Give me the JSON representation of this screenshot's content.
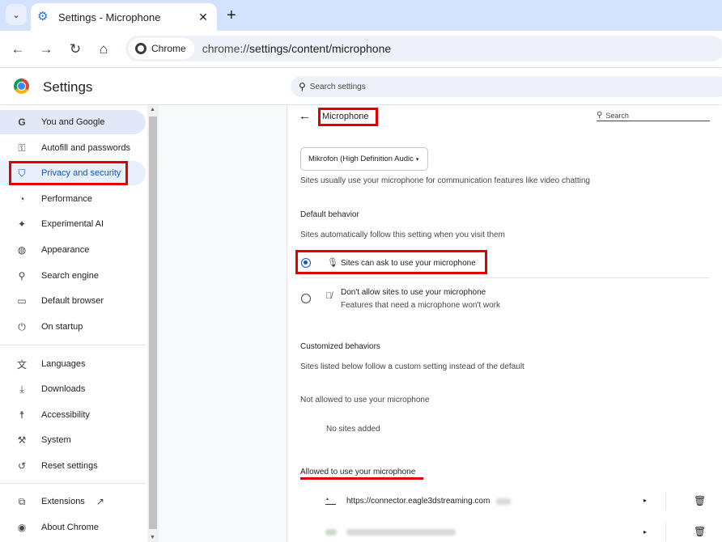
{
  "browser": {
    "tab_dropdown_icon": "chevron-down-icon",
    "tab_title": "Settings - Microphone",
    "tab_close": "✕",
    "new_tab": "+",
    "chip_label": "Chrome",
    "url_prefix": "chrome://",
    "url_rest": "settings/content/microphone"
  },
  "header": {
    "title": "Settings",
    "search_placeholder": "Search settings"
  },
  "sidebar": {
    "items": [
      {
        "label": "You and Google",
        "icon": "google-icon",
        "glyph": "G"
      },
      {
        "label": "Autofill and passwords",
        "icon": "key-icon",
        "glyph": "⚿"
      },
      {
        "label": "Privacy and security",
        "icon": "shield-icon",
        "glyph": "⛉"
      },
      {
        "label": "Performance",
        "icon": "speedometer-icon",
        "glyph": "◔"
      },
      {
        "label": "Experimental AI",
        "icon": "sparkle-icon",
        "glyph": "✦"
      },
      {
        "label": "Appearance",
        "icon": "palette-icon",
        "glyph": "◍"
      },
      {
        "label": "Search engine",
        "icon": "search-icon",
        "glyph": "⚲"
      },
      {
        "label": "Default browser",
        "icon": "browser-icon",
        "glyph": "▭"
      },
      {
        "label": "On startup",
        "icon": "power-icon",
        "glyph": "⏻"
      },
      {
        "label": "Languages",
        "icon": "translate-icon",
        "glyph": "文"
      },
      {
        "label": "Downloads",
        "icon": "download-icon",
        "glyph": "⤓"
      },
      {
        "label": "Accessibility",
        "icon": "accessibility-icon",
        "glyph": "☨"
      },
      {
        "label": "System",
        "icon": "wrench-icon",
        "glyph": "⚒"
      },
      {
        "label": "Reset settings",
        "icon": "reset-icon",
        "glyph": "↺"
      },
      {
        "label": "Extensions",
        "icon": "puzzle-icon",
        "glyph": "⧉"
      },
      {
        "label": "About Chrome",
        "icon": "chrome-icon",
        "glyph": "◉"
      }
    ],
    "extensions_external_icon": "external-link-icon"
  },
  "content": {
    "back_icon": "arrow-left-icon",
    "page_title": "Microphone",
    "search_label": "Search",
    "device_select": "Mikrofon (High Definition Audic",
    "intro": "Sites usually use your microphone for communication features like video chatting",
    "default_behavior_heading": "Default behavior",
    "default_behavior_desc": "Sites automatically follow this setting when you visit them",
    "option_allow": "Sites can ask to use your microphone",
    "option_block": "Don't allow sites to use your microphone",
    "option_block_sub": "Features that need a microphone won't work",
    "customized_heading": "Customized behaviors",
    "customized_desc": "Sites listed below follow a custom setting instead of the default",
    "not_allowed_heading": "Not allowed to use your microphone",
    "no_sites": "No sites added",
    "allowed_heading": "Allowed to use your microphone",
    "allowed_sites": [
      {
        "url": "https://connector.eagle3dstreaming.com"
      }
    ]
  },
  "colors": {
    "accent": "#0b57d0",
    "annotation_red": "#e00000"
  }
}
